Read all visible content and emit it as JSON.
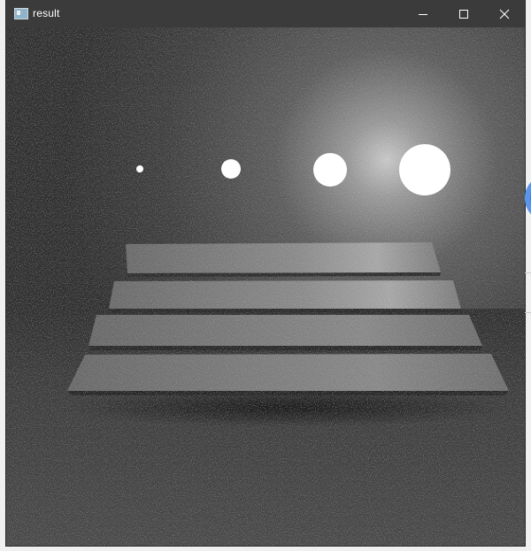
{
  "window": {
    "title": "result",
    "controls": [
      "minimize-icon",
      "maximize-icon",
      "close-icon"
    ]
  },
  "render": {
    "light_spheres": 4,
    "plates": 4,
    "colors": {
      "titlebar": "#3b3b3b",
      "background": "#333333",
      "floor": "#3a3a3a",
      "plate": "#7a7a7a",
      "sphere": "#ffffff"
    }
  }
}
